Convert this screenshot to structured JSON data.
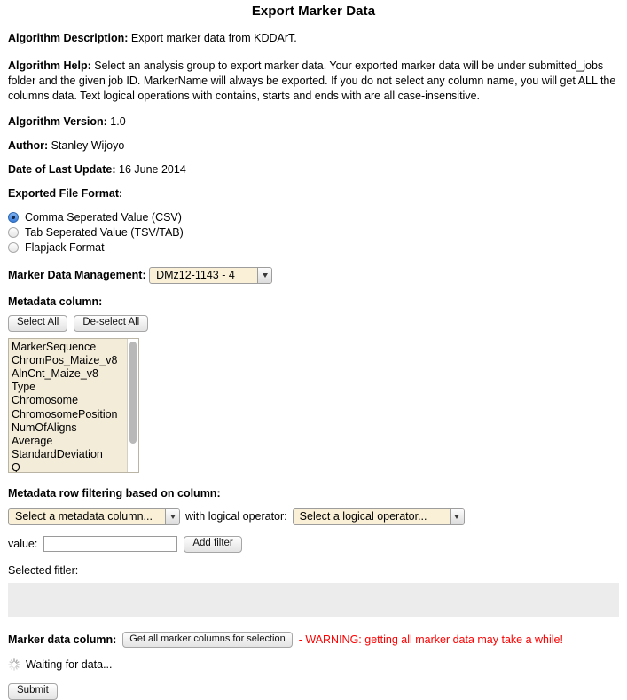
{
  "page": {
    "title": "Export Marker Data"
  },
  "info": {
    "description_label": "Algorithm Description:",
    "description_text": " Export marker data from KDDArT.",
    "help_label": "Algorithm Help:",
    "help_text": " Select an analysis group to export marker data. Your exported marker data will be under submitted_jobs folder and the given job ID. MarkerName will always be exported. If you do not select any column name, you will get ALL the columns data. Text logical operations with contains, starts and ends with are all case-insensitive.",
    "version_label": "Algorithm Version:",
    "version_value": " 1.0",
    "author_label": "Author:",
    "author_value": " Stanley Wijoyo",
    "last_update_label": "Date of Last Update:",
    "last_update_value": " 16 June 2014"
  },
  "export_format": {
    "label": "Exported File Format:",
    "options": [
      {
        "label": "Comma Seperated Value (CSV)",
        "selected": true
      },
      {
        "label": "Tab Seperated Value (TSV/TAB)",
        "selected": false
      },
      {
        "label": "Flapjack Format",
        "selected": false
      }
    ]
  },
  "marker_data_management": {
    "label": "Marker Data Management:",
    "selected_value": "DMz12-1143 - 4"
  },
  "metadata_column": {
    "label": "Metadata column:",
    "select_all_label": "Select All",
    "deselect_all_label": "De-select All",
    "items": [
      "MarkerSequence",
      "ChromPos_Maize_v8",
      "AlnCnt_Maize_v8",
      "Type",
      "Chromosome",
      "ChromosomePosition",
      "NumOfAligns",
      "Average",
      "StandardDeviation",
      "Q"
    ]
  },
  "row_filtering": {
    "label": "Metadata row filtering based on column:",
    "column_select_value": "Select a metadata column...",
    "operator_label": "with logical operator:",
    "operator_select_value": "Select a logical operator...",
    "value_label": "value:",
    "value_input": "",
    "value_placeholder": "",
    "add_filter_label": "Add filter",
    "selected_filter_label": "Selected fitler:"
  },
  "marker_data_column": {
    "label": "Marker data column:",
    "get_columns_button": "Get all marker columns for selection",
    "warning_text": "- WARNING: getting all marker data may take a while!",
    "warning_color": "#ff0000"
  },
  "status": {
    "waiting_text": "Waiting for data...",
    "spinner_icon": "loading-spinner-icon"
  },
  "submit": {
    "label": "Submit"
  }
}
